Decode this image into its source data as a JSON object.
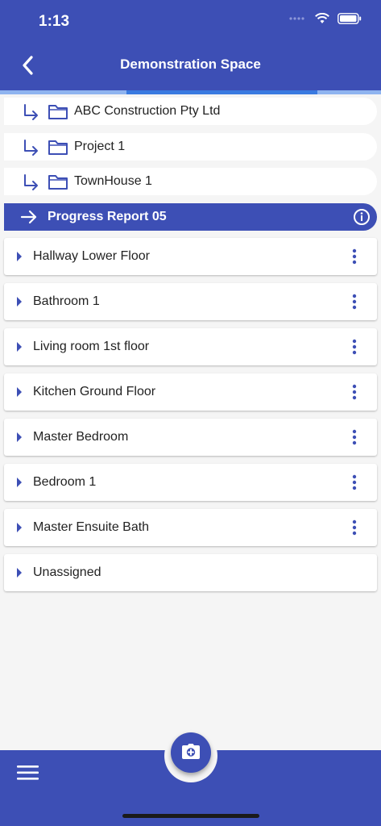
{
  "status_bar": {
    "time": "1:13"
  },
  "header": {
    "title": "Demonstration Space",
    "progress_fraction": 0.5
  },
  "breadcrumbs": [
    {
      "label": "ABC Construction Pty Ltd"
    },
    {
      "label": "Project 1"
    },
    {
      "label": "TownHouse 1"
    }
  ],
  "current_report": {
    "label": "Progress Report 05"
  },
  "rooms": [
    {
      "label": "Hallway Lower Floor",
      "has_menu": true
    },
    {
      "label": "Bathroom 1",
      "has_menu": true
    },
    {
      "label": "Living room 1st floor",
      "has_menu": true
    },
    {
      "label": "Kitchen Ground Floor",
      "has_menu": true
    },
    {
      "label": "Master Bedroom",
      "has_menu": true
    },
    {
      "label": "Bedroom 1",
      "has_menu": true
    },
    {
      "label": "Master Ensuite Bath",
      "has_menu": true
    },
    {
      "label": "Unassigned",
      "has_menu": false
    }
  ],
  "colors": {
    "primary": "#3d4fb5",
    "progress_track": "#8fb4ef",
    "progress_fill": "#3a7ae0"
  },
  "icons": {
    "back": "chevron-left-icon",
    "breadcrumb_arrow": "subdirectory-arrow-icon",
    "folder": "folder-icon",
    "current": "arrow-right-icon",
    "info": "info-icon",
    "expand": "caret-right-icon",
    "more": "more-vertical-icon",
    "menu": "hamburger-menu-icon",
    "camera": "camera-icon"
  }
}
